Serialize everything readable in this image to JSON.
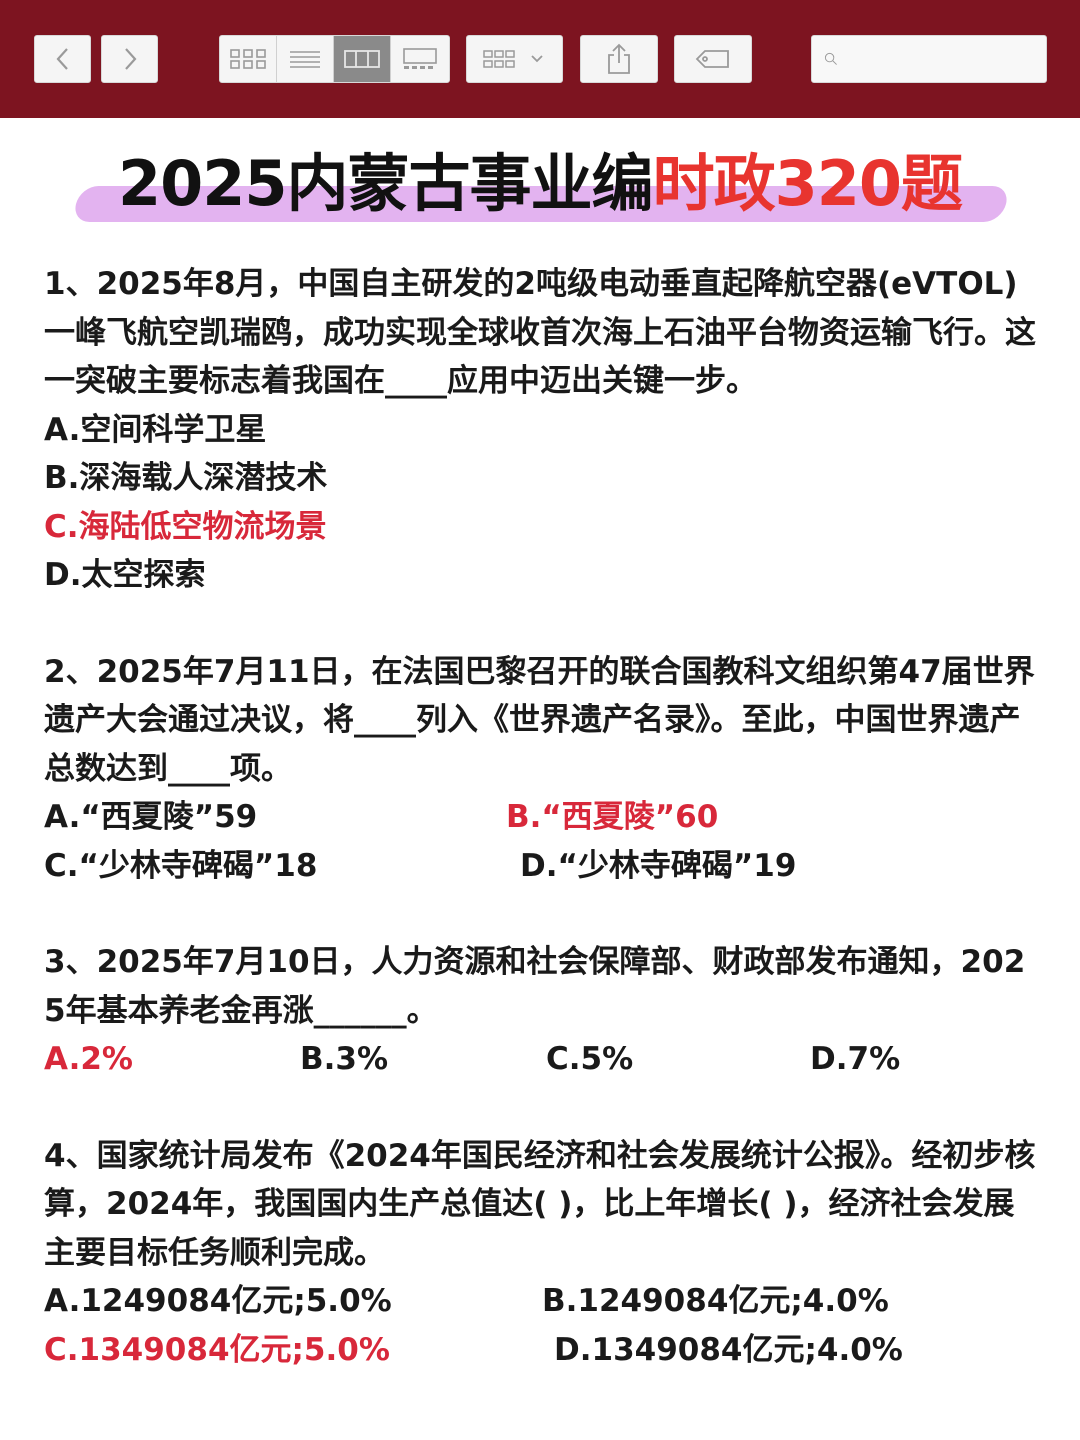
{
  "colors": {
    "toolbar_bg": "#7d1420",
    "title_highlight": "#e3b3f0",
    "title_red": "#e8342f",
    "correct_answer": "#d8283a",
    "text": "#1a1a1a"
  },
  "toolbar": {
    "icons": [
      "chevron-left-icon",
      "chevron-right-icon",
      "grid-view-icon",
      "list-view-icon",
      "column-view-icon",
      "gallery-view-icon",
      "group-by-icon",
      "share-icon",
      "tag-icon",
      "search-icon"
    ],
    "active_view": "column-view",
    "search_placeholder": ""
  },
  "title": {
    "part1": "2025内蒙古事业编",
    "part2": "时政320题"
  },
  "questions": [
    {
      "text": "1、2025年8月，中国自主研发的2吨级电动垂直起降航空器(eVTOL)一峰飞航空凯瑞鸥，成功实现全球收首次海上石油平台物资运输飞行。这一突破主要标志着我国在____应用中迈出关键一步。",
      "options": [
        "A.空间科学卫星",
        "B.深海载人深潜技术",
        "C.海陆低空物流场景",
        "D.太空探索"
      ],
      "answer": "C"
    },
    {
      "text": "2、2025年7月11日，在法国巴黎召开的联合国教科文组织第47届世界遗产大会通过决议，将____列入《世界遗产名录》。至此，中国世界遗产总数达到____项。",
      "options": [
        "A.“西夏陵”59",
        "B.“西夏陵”60",
        "C.“少林寺碑碣”18",
        "D.“少林寺碑碣”19"
      ],
      "answer": "B"
    },
    {
      "text": "3、2025年7月10日，人力资源和社会保障部、财政部发布通知，2025年基本养老金再涨______。",
      "options": [
        "A.2%",
        "B.3%",
        "C.5%",
        "D.7%"
      ],
      "answer": "A"
    },
    {
      "text": "4、国家统计局发布《2024年国民经济和社会发展统计公报》。经初步核算，2024年，我国国内生产总值达(    )，比上年增长(  )，经济社会发展主要目标任务顺利完成。",
      "options": [
        "A.1249084亿元;5.0%",
        "B.1249084亿元;4.0%",
        "C.1349084亿元;5.0%",
        "D.1349084亿元;4.0%"
      ],
      "answer": "C"
    }
  ]
}
